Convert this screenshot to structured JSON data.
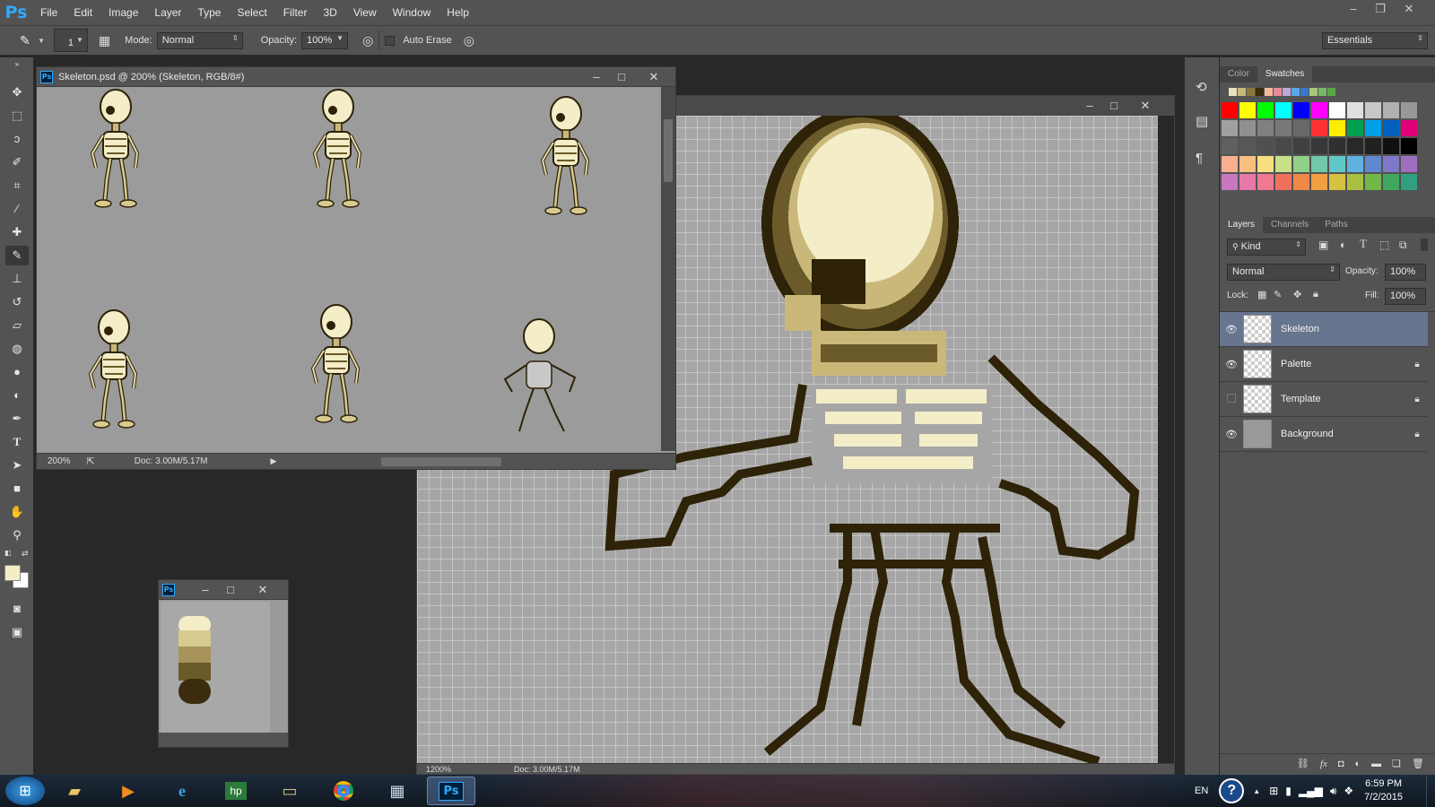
{
  "app": {
    "logo": "Ps"
  },
  "menu": [
    "File",
    "Edit",
    "Image",
    "Layer",
    "Type",
    "Select",
    "Filter",
    "3D",
    "View",
    "Window",
    "Help"
  ],
  "options": {
    "brush_size": "1",
    "mode_label": "Mode:",
    "mode_value": "Normal",
    "opacity_label": "Opacity:",
    "opacity_value": "100%",
    "auto_erase_label": "Auto Erase",
    "workspace": "Essentials"
  },
  "doc_main": {
    "title": "Skeleton.psd @ 200% (Skeleton, RGB/8#)",
    "zoom": "200%",
    "doc_size": "Doc: 3.00M/5.17M"
  },
  "doc_zoomed": {
    "zoom": "1200%",
    "doc_size": "Doc: 3.00M/5.17M"
  },
  "color_panel": {
    "tabs": [
      "Color",
      "Swatches"
    ],
    "active_tab": "Swatches"
  },
  "layers_panel": {
    "tabs": [
      "Layers",
      "Channels",
      "Paths"
    ],
    "filter_kind": "Kind",
    "blend_mode": "Normal",
    "opacity_label": "Opacity:",
    "opacity_value": "100%",
    "lock_label": "Lock:",
    "fill_label": "Fill:",
    "fill_value": "100%",
    "layers": [
      {
        "name": "Skeleton",
        "visible": true,
        "locked": false,
        "selected": true
      },
      {
        "name": "Palette",
        "visible": true,
        "locked": true,
        "selected": false
      },
      {
        "name": "Template",
        "visible": false,
        "locked": true,
        "selected": false
      },
      {
        "name": "Background",
        "visible": true,
        "locked": true,
        "selected": false
      }
    ]
  },
  "taskbar": {
    "language": "EN",
    "time": "6:59 PM",
    "date": "7/2/2015"
  },
  "colors": {
    "ui_panel": "#535353",
    "selected_layer": "#67758f",
    "bone_light": "#f3edc8",
    "bone_mid": "#c9b87a",
    "bone_dark": "#6b5a2a",
    "outline": "#2e2208"
  }
}
